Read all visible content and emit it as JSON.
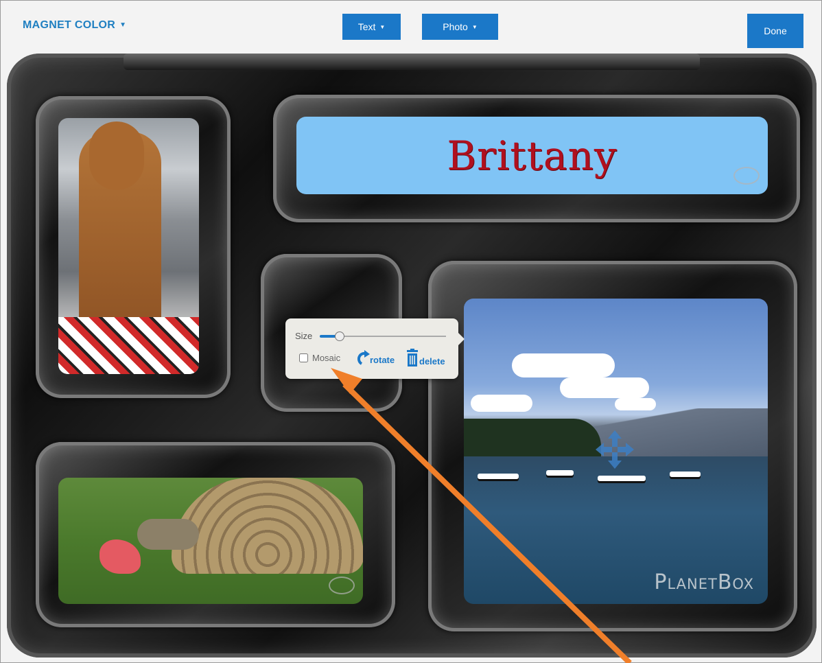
{
  "toolbar": {
    "magnet_color_label": "MAGNET COLOR",
    "text_label": "Text",
    "photo_label": "Photo",
    "done_label": "Done"
  },
  "name_plate": {
    "text": "Brittany",
    "background_color": "#80c4f5",
    "text_color": "#b0101e"
  },
  "watermark": "PlanetBox",
  "popup": {
    "size_label": "Size",
    "size_value_fraction": 0.15,
    "mosaic_label": "Mosaic",
    "mosaic_checked": false,
    "rotate_label": "rotate",
    "delete_label": "delete"
  },
  "colors": {
    "accent": "#1b78c8",
    "annotation_arrow": "#f07f2a"
  }
}
